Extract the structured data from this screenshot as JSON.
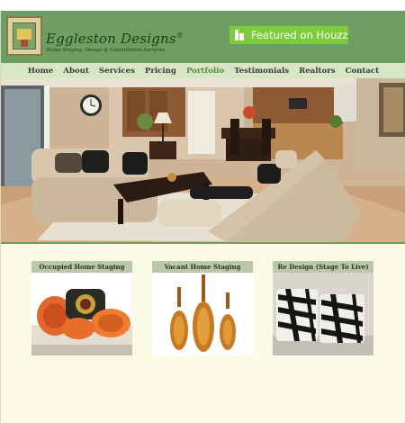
{
  "header": {
    "brand_name": "Eggleston Designs",
    "brand_mark": "®",
    "tagline": "Home Staging, Design & Consultation Services",
    "houzz_label": "Featured on Houzz"
  },
  "nav": {
    "items": [
      "Home",
      "About",
      "Services",
      "Pricing",
      "Portfolio",
      "Testimonials",
      "Realtors",
      "Contact"
    ],
    "active": "Portfolio"
  },
  "hero": {
    "icon": "living-room-photo"
  },
  "cards": [
    {
      "title": "Occupied Home Staging",
      "icon": "pillows-photo"
    },
    {
      "title": "Vacant Home Staging",
      "icon": "vases-photo"
    },
    {
      "title": "Re Design (Stage To Live)",
      "icon": "zebra-ottomans-photo"
    }
  ],
  "colors": {
    "header_bg": "#6e9e62",
    "nav_bg": "#d7e7c5",
    "active_nav": "#4a8f36",
    "page_bg": "#fcfce6",
    "card_title_bg": "#b9c8a7",
    "houzz_green": "#7ccb3a"
  }
}
